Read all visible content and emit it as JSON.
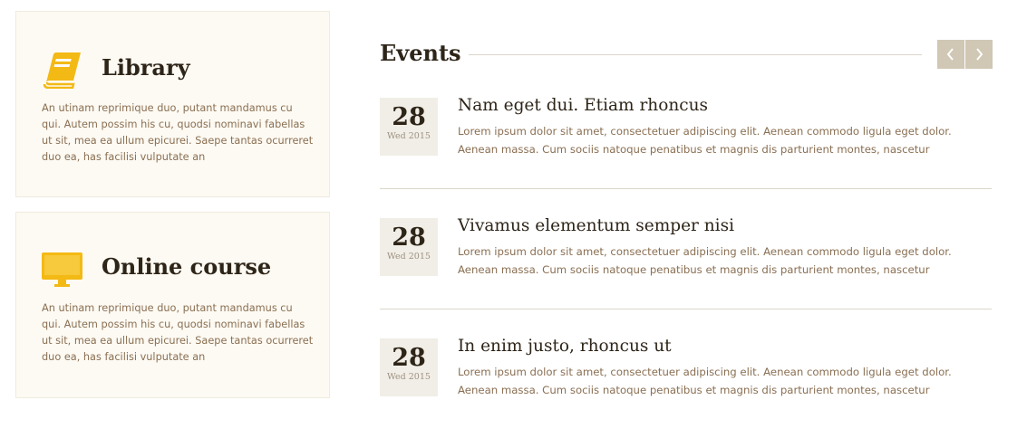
{
  "features": [
    {
      "icon": "book-icon",
      "title": "Library",
      "text": "An utinam reprimique duo, putant mandamus cu qui. Autem possim his cu, quodsi nominavi fabellas ut sit, mea ea ullum epicurei. Saepe tantas ocurreret duo ea, has facilisi vulputate an"
    },
    {
      "icon": "monitor-icon",
      "title": "Online course",
      "text": "An utinam reprimique duo, putant mandamus cu qui. Autem possim his cu, quodsi nominavi fabellas ut sit, mea ea ullum epicurei. Saepe tantas ocurreret duo ea, has facilisi vulputate an"
    }
  ],
  "events": {
    "heading": "Events",
    "items": [
      {
        "day": "28",
        "date_sub": "Wed 2015",
        "title": "Nam eget dui. Etiam rhoncus",
        "text": "Lorem ipsum dolor sit amet, consectetuer adipiscing elit. Aenean commodo ligula eget dolor. Aenean massa. Cum sociis natoque penatibus et magnis dis parturient montes, nascetur"
      },
      {
        "day": "28",
        "date_sub": "Wed 2015",
        "title": "Vivamus elementum semper nisi",
        "text": "Lorem ipsum dolor sit amet, consectetuer adipiscing elit. Aenean commodo ligula eget dolor. Aenean massa. Cum sociis natoque penatibus et magnis dis parturient montes, nascetur"
      },
      {
        "day": "28",
        "date_sub": "Wed 2015",
        "title": "In enim justo, rhoncus ut",
        "text": "Lorem ipsum dolor sit amet, consectetuer adipiscing elit. Aenean commodo ligula eget dolor. Aenean massa. Cum sociis natoque penatibus et magnis dis parturient montes, nascetur"
      }
    ]
  },
  "colors": {
    "accent": "#f3b915",
    "card_bg": "#fdfaf3",
    "nav_button": "#d0c7b4",
    "date_bg": "#f1eee7"
  }
}
